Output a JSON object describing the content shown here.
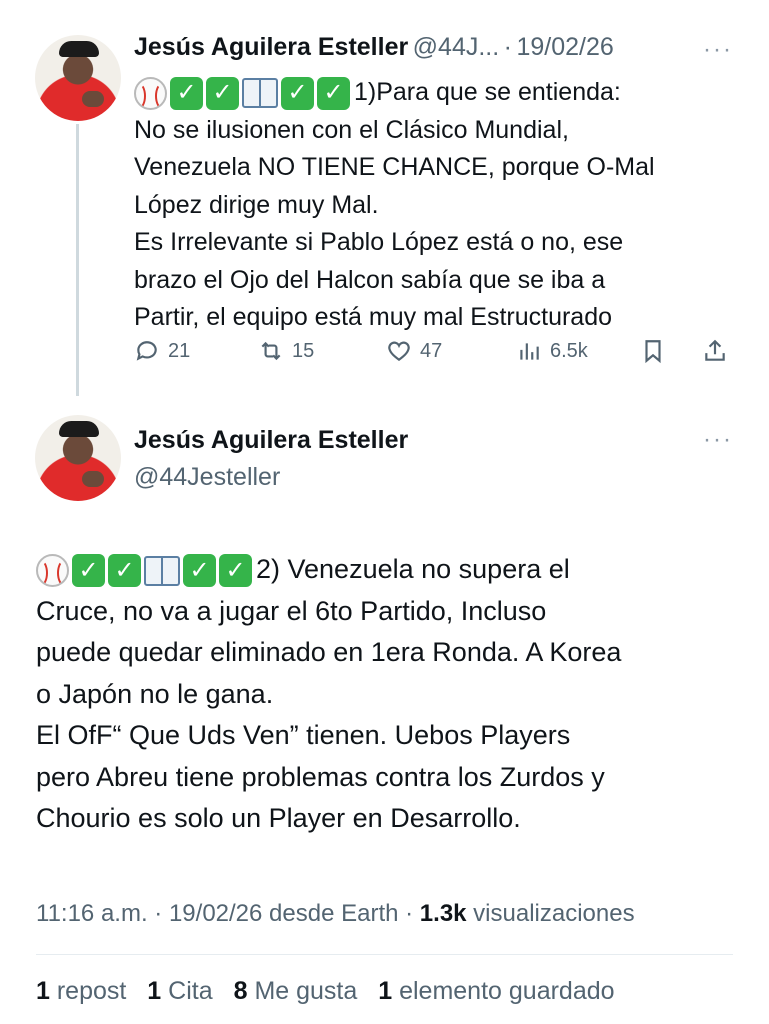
{
  "tweet1": {
    "author_name": "Jesús Aguilera Esteller",
    "handle_truncated": "@44J...",
    "separator": "·",
    "date": "19/02/26",
    "more": "···",
    "lines": [
      "1)Para que se entienda:",
      "No se ilusionen con el Clásico Mundial,",
      "Venezuela NO TIENE CHANCE, porque O-Mal",
      "López dirige muy Mal.",
      "Es Irrelevante si Pablo López está o no, ese",
      "brazo el Ojo del Halcon sabía que se iba a",
      "Partir, el equipo está muy mal Estructurado"
    ],
    "actions": {
      "replies": "21",
      "reposts": "15",
      "likes": "47",
      "views": "6.5k"
    }
  },
  "tweet2": {
    "author_name": "Jesús Aguilera Esteller",
    "handle": "@44Jesteller",
    "more": "···",
    "lines": [
      "2) Venezuela no supera el",
      "Cruce, no va a jugar el 6to Partido, Incluso",
      "puede quedar eliminado en 1era Ronda. A Korea",
      "o Japón no le gana.",
      "El OfF“ Que Uds Ven” tienen. Uebos Players",
      "pero Abreu tiene problemas contra los Zurdos y",
      "Chourio es solo un Player en Desarrollo."
    ],
    "timestamp_text": "11:16 a.m. · 19/02/26 desde Earth · ",
    "views_count": "1.3k",
    "views_label": " visualizaciones",
    "stats": [
      {
        "count": "1",
        "label": "repost"
      },
      {
        "count": "1",
        "label": "Cita"
      },
      {
        "count": "8",
        "label": "Me gusta"
      },
      {
        "count": "1",
        "label": "elemento guardado"
      }
    ]
  },
  "icons": [
    "baseball-icon",
    "check-mark-icon",
    "open-book-icon",
    "reply-icon",
    "repost-icon",
    "like-icon",
    "views-icon",
    "bookmark-icon",
    "share-icon"
  ],
  "colors": {
    "text": "#0f1419",
    "muted": "#536471",
    "check_green": "#35b44a",
    "thread_line": "#cfd9de"
  }
}
